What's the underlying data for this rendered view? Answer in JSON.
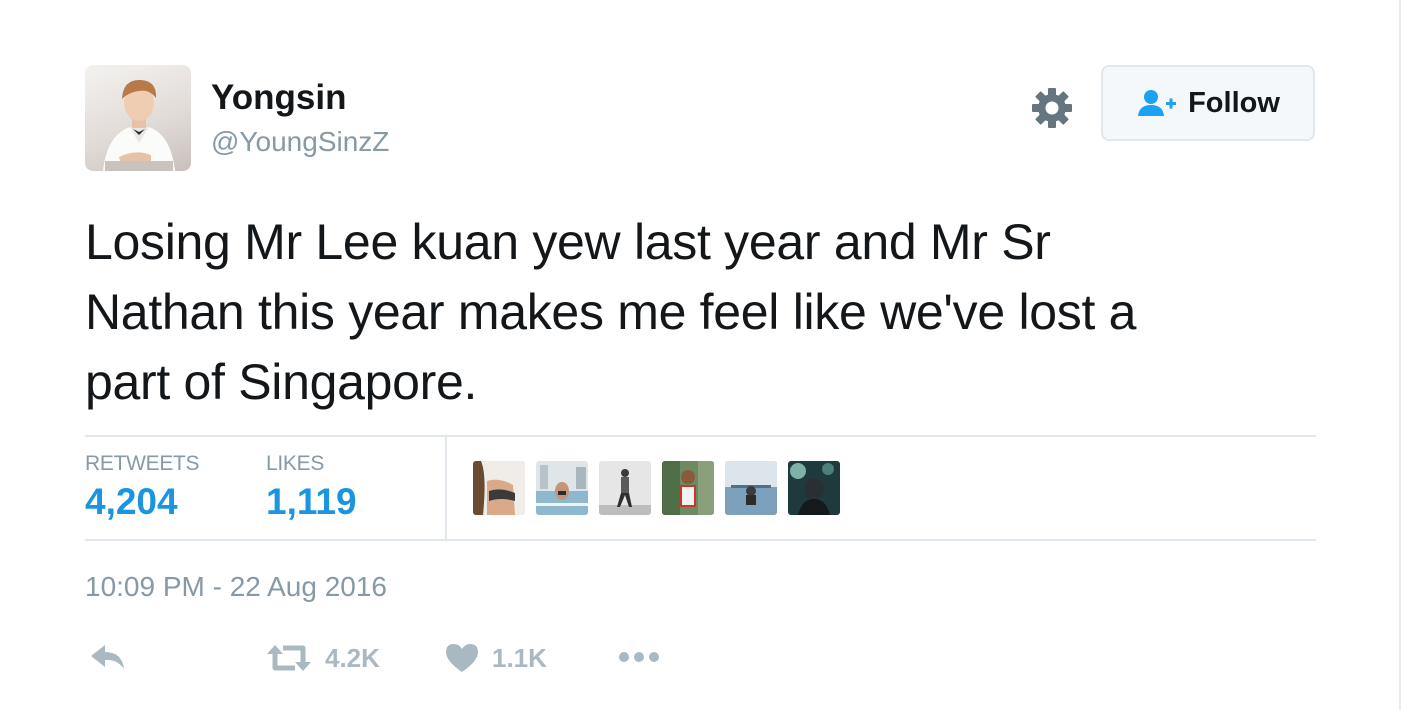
{
  "tweet": {
    "user": {
      "name": "Yongsin",
      "handle": "@YoungSinzZ"
    },
    "follow_label": "Follow",
    "lines": [
      "Losing Mr Lee kuan yew last year and Mr Sr",
      "Nathan this year makes me feel like we've lost a",
      "part of Singapore."
    ],
    "stats": {
      "retweets_label": "RETWEETS",
      "retweets_value": "4,204",
      "likes_label": "LIKES",
      "likes_value": "1,119"
    },
    "likers": [
      {
        "icon": "liker-avatar-1"
      },
      {
        "icon": "liker-avatar-2"
      },
      {
        "icon": "liker-avatar-3"
      },
      {
        "icon": "liker-avatar-4"
      },
      {
        "icon": "liker-avatar-5"
      },
      {
        "icon": "liker-avatar-6"
      }
    ],
    "timestamp": "10:09 PM - 22 Aug 2016",
    "actions": {
      "reply_icon": "reply-icon",
      "retweet_icon": "retweet-icon",
      "retweet_count": "4.2K",
      "like_icon": "heart-icon",
      "like_count": "1.1K",
      "more_icon": "more-dots-icon"
    }
  },
  "colors": {
    "accent": "#1b95e0",
    "muted": "#8899a6",
    "action": "#aab8c2",
    "text": "#14171a",
    "divider": "#e1e8ed"
  }
}
